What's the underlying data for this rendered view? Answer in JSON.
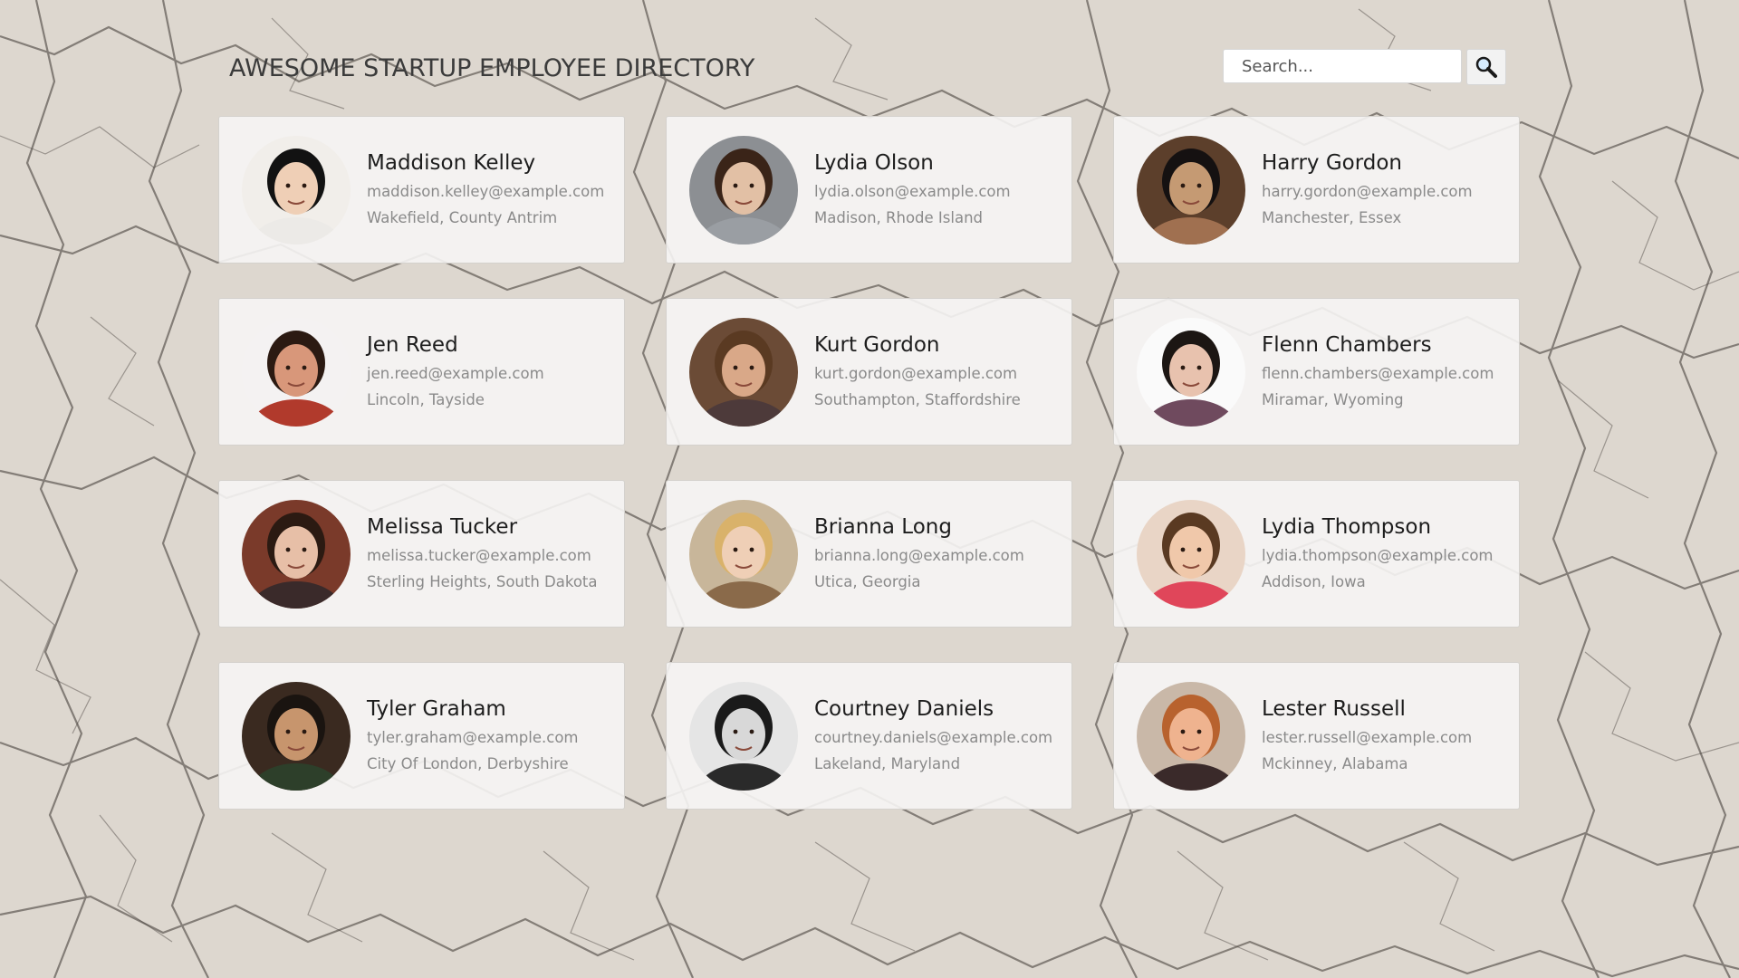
{
  "header": {
    "title": "AWESOME STARTUP EMPLOYEE DIRECTORY"
  },
  "search": {
    "placeholder": "Search...",
    "button_icon": "search-icon"
  },
  "employees": [
    {
      "name": "Maddison Kelley",
      "email": "maddison.kelley@example.com",
      "location": "Wakefield, County Antrim",
      "avatar": {
        "bg": "#f1eeea",
        "skin": "#efcfb6",
        "hair": "#121212",
        "shirt": "#eceae7"
      }
    },
    {
      "name": "Lydia Olson",
      "email": "lydia.olson@example.com",
      "location": "Madison, Rhode Island",
      "avatar": {
        "bg": "#8c8f93",
        "skin": "#e2c0a5",
        "hair": "#3a2418",
        "shirt": "#9a9ea3"
      }
    },
    {
      "name": "Harry Gordon",
      "email": "harry.gordon@example.com",
      "location": "Manchester, Essex",
      "avatar": {
        "bg": "#5c3f2b",
        "skin": "#c59a73",
        "hair": "#151111",
        "shirt": "#a07050"
      }
    },
    {
      "name": "Jen Reed",
      "email": "jen.reed@example.com",
      "location": "Lincoln, Tayside",
      "avatar": {
        "bg": "#f4f2f2",
        "skin": "#d8977a",
        "hair": "#2b1a12",
        "shirt": "#b13a2c"
      }
    },
    {
      "name": "Kurt Gordon",
      "email": "kurt.gordon@example.com",
      "location": "Southampton, Staffordshire",
      "avatar": {
        "bg": "#6b4b36",
        "skin": "#d9a888",
        "hair": "#5a3a22",
        "shirt": "#4d3a3a"
      }
    },
    {
      "name": "Flenn Chambers",
      "email": "flenn.chambers@example.com",
      "location": "Miramar, Wyoming",
      "avatar": {
        "bg": "#fafafa",
        "skin": "#e8c2ae",
        "hair": "#1c1613",
        "shirt": "#6f4a5e"
      }
    },
    {
      "name": "Melissa Tucker",
      "email": "melissa.tucker@example.com",
      "location": "Sterling Heights, South Dakota",
      "avatar": {
        "bg": "#7a3a2a",
        "skin": "#e7bfa7",
        "hair": "#2b1a12",
        "shirt": "#3a2a2a"
      }
    },
    {
      "name": "Brianna Long",
      "email": "brianna.long@example.com",
      "location": "Utica, Georgia",
      "avatar": {
        "bg": "#c8b69a",
        "skin": "#efcfb6",
        "hair": "#d9b26a",
        "shirt": "#8a6a4a"
      }
    },
    {
      "name": "Lydia Thompson",
      "email": "lydia.thompson@example.com",
      "location": "Addison, Iowa",
      "avatar": {
        "bg": "#e9d5c6",
        "skin": "#f0c8aa",
        "hair": "#5a3a22",
        "shirt": "#e0465a"
      }
    },
    {
      "name": "Tyler Graham",
      "email": "tyler.graham@example.com",
      "location": "City Of London, Derbyshire",
      "avatar": {
        "bg": "#3a2a20",
        "skin": "#c7956d",
        "hair": "#1a1410",
        "shirt": "#2d3f2a"
      }
    },
    {
      "name": "Courtney Daniels",
      "email": "courtney.daniels@example.com",
      "location": "Lakeland, Maryland",
      "avatar": {
        "bg": "#e5e5e5",
        "skin": "#d8d8d8",
        "hair": "#1a1a1a",
        "shirt": "#2a2a2a"
      }
    },
    {
      "name": "Lester Russell",
      "email": "lester.russell@example.com",
      "location": "Mckinney, Alabama",
      "avatar": {
        "bg": "#c9b8a8",
        "skin": "#efb38f",
        "hair": "#b8622e",
        "shirt": "#3a2a2a"
      }
    }
  ]
}
